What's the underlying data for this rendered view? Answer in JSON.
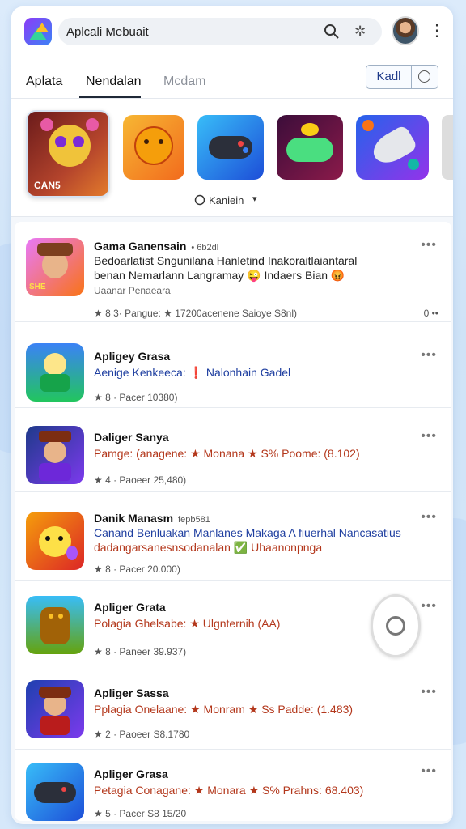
{
  "search": {
    "value": "Aplcali Mebuait"
  },
  "tabs": [
    {
      "label": "Aplata"
    },
    {
      "label": "Nendalan"
    },
    {
      "label": "Mcdam"
    }
  ],
  "filter_button": {
    "label": "Kadl"
  },
  "carousel": {
    "feature_label": "CAN5",
    "caption": "Kaniein"
  },
  "list": [
    {
      "title": "Gama Ganensain",
      "title_extra": "• 6b2dl",
      "desc_line1": "Bedoarlatist Sngunilana Hanletind Inakoraitlaiantaral",
      "desc_line2": "benan Nemarlann Langramay 😜 Indaers Bian 😡",
      "sub": "Uaanar Penaeara",
      "meta": "★ 8 3· Pangue:  ★ 17200acenene Saioye S8nl)",
      "trail": "0 ••",
      "icon": "hero-warrior-icon"
    },
    {
      "title": "Apligey Grasa",
      "desc_line1": "Aenige Kenkeeca: ❗ Nalonhain Gadel",
      "meta": "★ 8 · Pacer 10380)",
      "icon": "cartoon-runner-icon"
    },
    {
      "title": "Daliger Sanya",
      "desc_line1": "Pamge: (anagene: ★ Monana ★ S% Poome: (8.102)",
      "meta": "★ 4 · Paoeer 25,480)",
      "icon": "wizard-icon"
    },
    {
      "title": "Danik Manasm",
      "title_extra": "fepb581",
      "desc_line1": "Canand Benluakan Manlanes Makaga A fiuerhal Nancasatius",
      "desc_line2": "dadangarsanesnsodanalan ✅ Uhaanonpnga",
      "meta": "★ 8 · Pacer 20.000)",
      "icon": "yellow-creature-icon"
    },
    {
      "title": "Apliger Grata",
      "desc_line1": "Polagia Ghelsabe: ★ Ulgnternih (AA)",
      "meta": "★ 8 · Paneer 39.937)",
      "icon": "golem-icon"
    },
    {
      "title": "Apliger Sassa",
      "desc_line1": "Pplagia Onelaane: ★ Monram ★ Ss Padde: (1.483)",
      "meta": "★ 2 · Paoeer S8.1780",
      "icon": "archer-girl-icon"
    },
    {
      "title": "Apliger Grasa",
      "desc_line1": "Petagia Conagane: ★ Monara ★ S% Prahns: 68.403)",
      "meta": "★ 5 · Pacer S8 15/20",
      "icon": "gamepad-icon"
    }
  ],
  "colors": {
    "accent": "#1e3a8a",
    "link_blue": "#1f3fa0",
    "desc_orange": "#b3371b"
  }
}
